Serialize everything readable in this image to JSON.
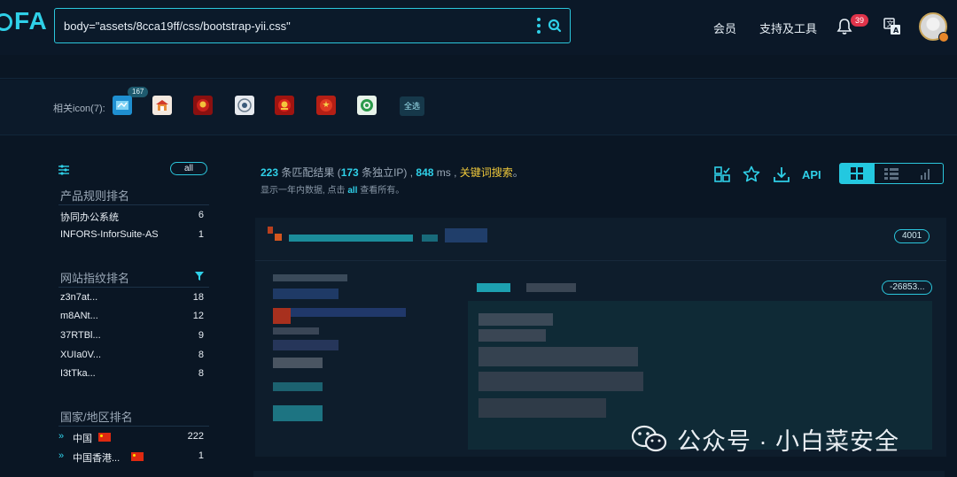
{
  "header": {
    "logo": "FA",
    "search_query": "body=\"assets/8cca19ff/css/bootstrap-yii.css\"",
    "nav": [
      "会员",
      "支持及工具"
    ],
    "notification_count": "39"
  },
  "icon_row": {
    "label": "相关icon(7):",
    "first_icon_count": "167",
    "select_all": "全选"
  },
  "sidebar": {
    "all_label": "all",
    "product_title": "产品规则排名",
    "products": [
      {
        "label": "协同办公系统",
        "count": "6"
      },
      {
        "label": "INFORS-InforSuite-AS",
        "count": "1"
      }
    ],
    "fingerprint_title": "网站指纹排名",
    "fingerprints": [
      {
        "label": "z3n7at...",
        "count": "18"
      },
      {
        "label": "m8ANt...",
        "count": "12"
      },
      {
        "label": "37RTBl...",
        "count": "9"
      },
      {
        "label": "XUIa0V...",
        "count": "8"
      },
      {
        "label": "I3tTka...",
        "count": "8"
      }
    ],
    "country_title": "国家/地区排名",
    "countries": [
      {
        "label": "中国",
        "count": "222"
      },
      {
        "label": "中国香港...",
        "count": "1"
      }
    ]
  },
  "results": {
    "total": "223",
    "total_suffix": " 条匹配结果 (",
    "ip_count": "173",
    "ip_suffix": " 条独立IP) ,  ",
    "ms": "848",
    "ms_suffix": " ms ,  ",
    "keyword_search": "关键词搜索",
    "period": "。",
    "sub_prefix": "显示一年内数据, 点击 ",
    "sub_all": "all",
    "sub_suffix": " 查看所有。",
    "api_label": "API",
    "port_1": "4001",
    "port_2": "-26853..."
  },
  "watermark": {
    "text": "公众号 · 小白菜安全"
  }
}
